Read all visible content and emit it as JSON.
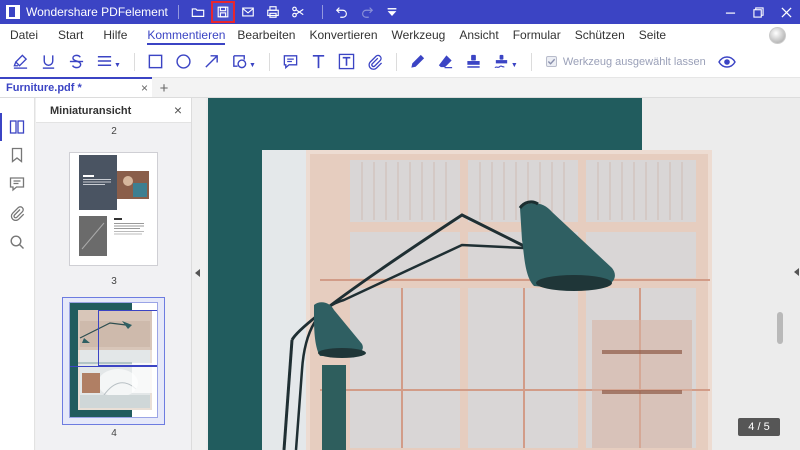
{
  "titlebar": {
    "app_title": "Wondershare PDFelement",
    "quick_actions": [
      "folder-open-icon",
      "save-icon",
      "email-icon",
      "print-icon",
      "scissors-icon",
      "undo-icon",
      "redo-icon",
      "customize-icon"
    ],
    "highlighted_action": "save-icon"
  },
  "menu": {
    "items": [
      "Datei",
      "Start",
      "Hilfe",
      "Kommentieren",
      "Bearbeiten",
      "Konvertieren",
      "Werkzeug",
      "Ansicht",
      "Formular",
      "Schützen",
      "Seite"
    ],
    "active": "Kommentieren"
  },
  "toolbar": {
    "tools": [
      "highlight-icon",
      "underline-icon",
      "strikethrough-icon",
      "text-alignment-icon",
      "rectangle-icon",
      "ellipse-icon",
      "arrow-icon",
      "shape-icon",
      "note-icon",
      "typewriter-icon",
      "textbox-icon",
      "attachment-icon",
      "pencil-icon",
      "eraser-icon",
      "stamp-icon",
      "signature-icon"
    ],
    "keep_tool_label": "Werkzeug ausgewählt lassen",
    "keep_tool_checked": true
  },
  "tabs": {
    "document_tab": "Furniture.pdf *",
    "close_glyph": "×",
    "add_glyph": "+"
  },
  "sidebar": {
    "rail_icons": [
      "thumbnails-icon",
      "bookmark-icon",
      "comments-icon",
      "attachments-icon",
      "search-icon"
    ],
    "active_rail_icon": "thumbnails-icon"
  },
  "thumbnails": {
    "title": "Miniaturansicht",
    "close_glyph": "×",
    "pages": [
      {
        "number": "2"
      },
      {
        "number": "3"
      },
      {
        "number": "4",
        "selected": true
      }
    ]
  },
  "viewer": {
    "current_page": 4,
    "total_pages": 5,
    "page_indicator": "4 / 5"
  },
  "colors": {
    "accent": "#3b44c4",
    "highlight_border": "#e8262e",
    "teal": "#215c5e",
    "lamp": "#2f5f62"
  }
}
